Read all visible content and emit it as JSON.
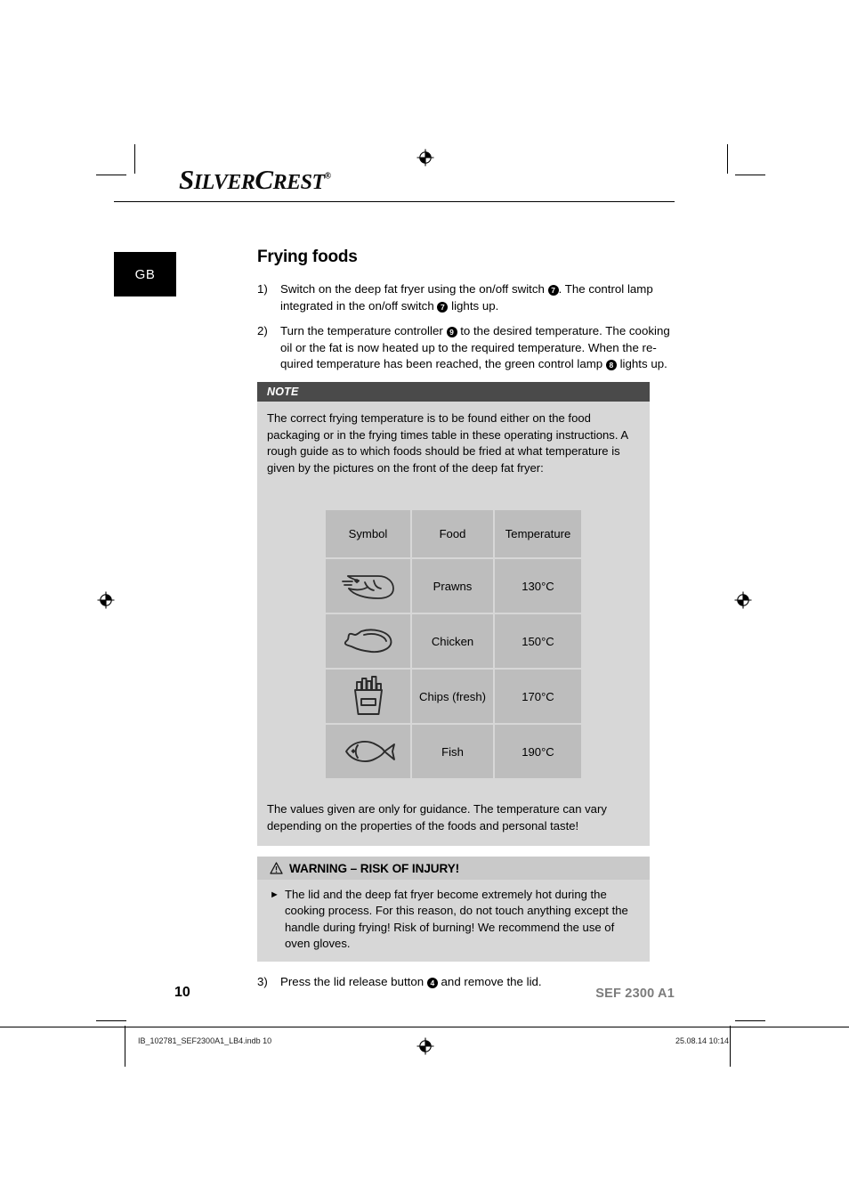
{
  "brand": {
    "name_part1": "S",
    "name_part2": "ILVER",
    "name_part3": "C",
    "name_part4": "REST",
    "registered": "®"
  },
  "language_badge": "GB",
  "section": {
    "title": "Frying foods"
  },
  "steps": [
    {
      "num": "1)",
      "segments": [
        {
          "type": "text",
          "value": "Switch on the deep fat fryer using the on/off switch "
        },
        {
          "type": "ref",
          "value": "7"
        },
        {
          "type": "text",
          "value": ". The control lamp integrated in the on/off switch "
        },
        {
          "type": "ref",
          "value": "7"
        },
        {
          "type": "text",
          "value": " lights up."
        }
      ]
    },
    {
      "num": "2)",
      "segments": [
        {
          "type": "text",
          "value": "Turn the temperature controller "
        },
        {
          "type": "ref",
          "value": "9"
        },
        {
          "type": "text",
          "value": " to the desired temperature. The cooking oil or the fat is now heated up to the required temperature. When the re-quired temperature has been reached, the green control lamp "
        },
        {
          "type": "ref",
          "value": "8"
        },
        {
          "type": "text",
          "value": " lights up."
        }
      ]
    }
  ],
  "note": {
    "heading": "NOTE",
    "body": "The correct frying temperature is to be found either on the food packaging or in the frying times table in these operating instructions. A rough guide as to which foods should be fried at what temperature is given by the pictures on the front of the deep fat fryer:",
    "footer": "The values given are only for guidance. The temperature can vary depending on the properties of the foods and personal taste!"
  },
  "food_table": {
    "headers": [
      "Symbol",
      "Food",
      "Temperature"
    ],
    "rows": [
      {
        "icon": "prawn-icon",
        "food": "Prawns",
        "temperature": "130°C"
      },
      {
        "icon": "chicken-drumstick-icon",
        "food": "Chicken",
        "temperature": "150°C"
      },
      {
        "icon": "chips-icon",
        "food": "Chips (fresh)",
        "temperature": "170°C"
      },
      {
        "icon": "fish-icon",
        "food": "Fish",
        "temperature": "190°C"
      }
    ]
  },
  "warning": {
    "icon": "warning-triangle-icon",
    "heading": "WARNING – RISK OF INJURY!",
    "bullet_glyph": "►",
    "body": "The lid and the deep fat fryer become extremely hot during the cooking process. For this reason, do not touch anything except the handle during frying! Risk of burning! We recommend the use of oven gloves."
  },
  "step3": {
    "num": "3)",
    "segments": [
      {
        "type": "text",
        "value": "Press the lid release button "
      },
      {
        "type": "ref",
        "value": "4"
      },
      {
        "type": "text",
        "value": " and remove the lid."
      }
    ]
  },
  "footer": {
    "page_number": "10",
    "model": "SEF 2300 A1"
  },
  "imposition": {
    "file": "IB_102781_SEF2300A1_LB4.indb   10",
    "date": "25.08.14   10:14"
  },
  "colors": {
    "note_bg": "#d7d7d7",
    "note_head_bg": "#4a4a4a",
    "warn_head_bg": "#c9c9c9",
    "table_cell_bg": "#bdbdbd",
    "model_gray": "#7c7c7c",
    "badge_bg": "#000000"
  }
}
